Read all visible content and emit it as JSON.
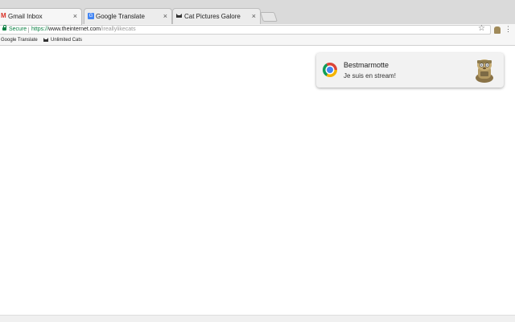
{
  "tabs": [
    {
      "title": "Gmail Inbox",
      "icon": "gmail-icon",
      "active": true
    },
    {
      "title": "Google Translate",
      "icon": "translate-icon",
      "active": false
    },
    {
      "title": "Cat Pictures Galore",
      "icon": "cat-icon",
      "active": false
    }
  ],
  "tab_close_glyph": "×",
  "omnibox": {
    "secure_label": "Secure",
    "scheme": "https://",
    "host": "www.theinternet.com",
    "path": "/ireallylikecats"
  },
  "bookmarks": [
    {
      "label": "Google Translate",
      "icon": "translate-icon"
    },
    {
      "label": "Unlimited Cats",
      "icon": "cat-icon"
    }
  ],
  "icons": {
    "star": "☆",
    "menu": "⋮"
  },
  "notification": {
    "title": "Bestmarmotte",
    "message": "Je suis en stream!",
    "app_icon": "chrome-icon",
    "image": "marmot-avatar"
  },
  "colors": {
    "secure_green": "#0b8043",
    "tabstrip_bg": "#dadada",
    "notification_bg": "#f2f2f2"
  }
}
